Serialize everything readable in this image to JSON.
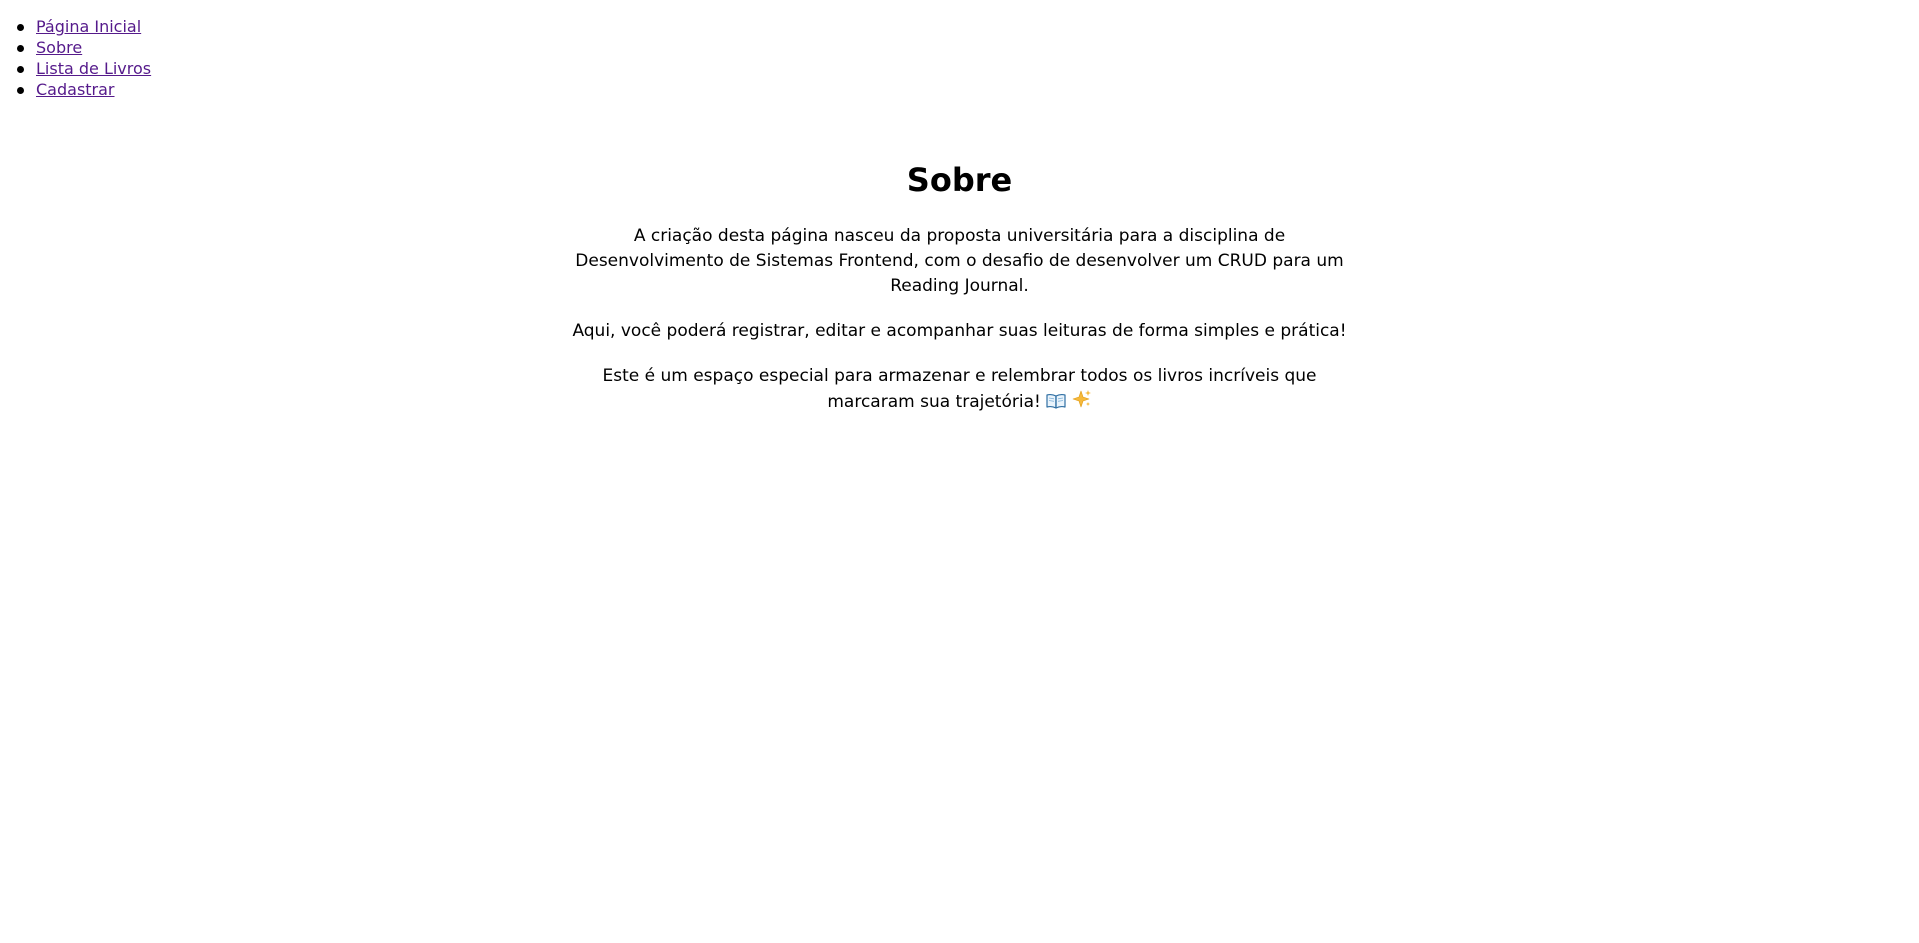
{
  "nav": {
    "items": [
      {
        "label": "Página Inicial"
      },
      {
        "label": "Sobre"
      },
      {
        "label": "Lista de Livros"
      },
      {
        "label": "Cadastrar"
      }
    ],
    "link_color": "#551a8b"
  },
  "main": {
    "title": "Sobre",
    "paragraphs": [
      "A criação desta página nasceu da proposta universitária para a disciplina de Desenvolvimento de Sistemas Frontend, com o desafio de desenvolver um CRUD para um Reading Journal.",
      "Aqui, você poderá registrar, editar e acompanhar suas leituras de forma simples e prática!",
      "Este é um espaço especial para armazenar e relembrar todos os livros incríveis que marcaram sua trajetória!"
    ],
    "trailing_icons": [
      "open-book-icon",
      "sparkles-icon"
    ]
  }
}
